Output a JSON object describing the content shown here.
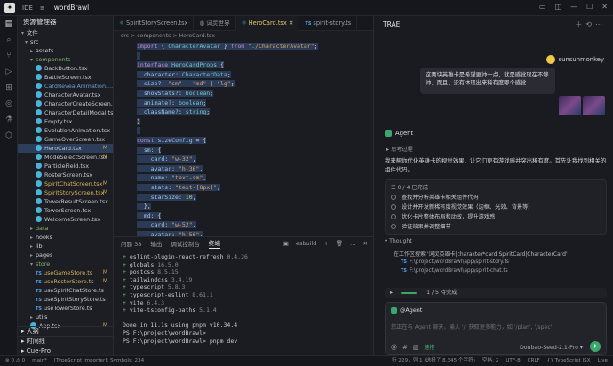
{
  "titlebar": {
    "ide_label": "IDE",
    "menu_label": "菜单",
    "project": "wordBrawl"
  },
  "explorer": {
    "title": "资源管理器",
    "root": "文件",
    "rows": [
      {
        "label": "src",
        "kind": "folder",
        "depth": 1,
        "open": true
      },
      {
        "label": "assets",
        "kind": "folder",
        "depth": 2,
        "open": false
      },
      {
        "label": "components",
        "kind": "folder",
        "depth": 2,
        "open": true,
        "state": "green"
      },
      {
        "label": "BackButton.tsx",
        "kind": "react",
        "depth": 3
      },
      {
        "label": "BattleScreen.tsx",
        "kind": "react",
        "depth": 3
      },
      {
        "label": "CardRevealAnimation....",
        "kind": "react",
        "depth": 3,
        "state": "del"
      },
      {
        "label": "CharacterAvatar.tsx",
        "kind": "react",
        "depth": 3
      },
      {
        "label": "CharacterCreateScreen.tsx",
        "kind": "react",
        "depth": 3
      },
      {
        "label": "CharacterDetailModal.tsx",
        "kind": "react",
        "depth": 3
      },
      {
        "label": "Empty.tsx",
        "kind": "react",
        "depth": 3
      },
      {
        "label": "EvolutionAnimation.tsx",
        "kind": "react",
        "depth": 3
      },
      {
        "label": "GameOverScreen.tsx",
        "kind": "react",
        "depth": 3
      },
      {
        "label": "HeroCard.tsx",
        "kind": "react",
        "depth": 3,
        "state": "sel",
        "badge": "M"
      },
      {
        "label": "ModeSelectScreen.tsx",
        "kind": "react",
        "depth": 3,
        "badge": "M"
      },
      {
        "label": "ParticleField.tsx",
        "kind": "react",
        "depth": 3
      },
      {
        "label": "RosterScreen.tsx",
        "kind": "react",
        "depth": 3
      },
      {
        "label": "SpiritChatScreen.tsx",
        "kind": "react",
        "depth": 3,
        "state": "mod",
        "badge": "M"
      },
      {
        "label": "SpiritStoryScreen.tsx",
        "kind": "react",
        "depth": 3,
        "state": "mod",
        "badge": "M"
      },
      {
        "label": "TowerResultScreen.tsx",
        "kind": "react",
        "depth": 3
      },
      {
        "label": "TowerScreen.tsx",
        "kind": "react",
        "depth": 3
      },
      {
        "label": "WelcomeScreen.tsx",
        "kind": "react",
        "depth": 3
      },
      {
        "label": "data",
        "kind": "folder",
        "depth": 2,
        "open": false,
        "state": "green"
      },
      {
        "label": "hooks",
        "kind": "folder",
        "depth": 2,
        "open": false
      },
      {
        "label": "lib",
        "kind": "folder",
        "depth": 2,
        "open": false
      },
      {
        "label": "pages",
        "kind": "folder",
        "depth": 2,
        "open": false
      },
      {
        "label": "store",
        "kind": "folder",
        "depth": 2,
        "open": true,
        "state": "green"
      },
      {
        "label": "useGameStore.ts",
        "kind": "ts",
        "depth": 3,
        "state": "mod",
        "badge": "M"
      },
      {
        "label": "useRosterStore.ts",
        "kind": "ts",
        "depth": 3,
        "state": "mod",
        "badge": "M"
      },
      {
        "label": "useSpiritChatStore.ts",
        "kind": "ts",
        "depth": 3
      },
      {
        "label": "useSpiritStoryStore.ts",
        "kind": "ts",
        "depth": 3
      },
      {
        "label": "useTowerStore.ts",
        "kind": "ts",
        "depth": 3
      },
      {
        "label": "utils",
        "kind": "folder",
        "depth": 2,
        "open": false
      },
      {
        "label": "App.tsx",
        "kind": "react",
        "depth": 2,
        "badge": "M"
      }
    ],
    "sections": [
      "大纲",
      "时间线",
      "Cue-Pro"
    ]
  },
  "editor": {
    "tabs": [
      {
        "label": "SpiritStoryScreen.tsx",
        "kind": "react",
        "active": false
      },
      {
        "label": "词灵世界",
        "kind": "web",
        "active": false
      },
      {
        "label": "HeroCard.tsx",
        "kind": "react",
        "active": true
      },
      {
        "label": "spirit-story.ts",
        "kind": "ts",
        "active": false
      }
    ],
    "breadcrumb": "src > components > HeroCard.tsx",
    "lines": [
      {
        "n": "",
        "html": "<span class=\"kw\">import</span> <span class=\"pl\">{ </span><span class=\"ty\">CharacterAvatar</span><span class=\"pl\"> } </span><span class=\"kw\">from</span> <span class=\"st\">\"./CharacterAvatar\"</span><span class=\"pl\">;</span>"
      },
      {
        "n": "",
        "html": ""
      },
      {
        "n": "",
        "html": "<span class=\"kw\">interface</span> <span class=\"ty\">HeroCardProps</span> <span class=\"pl\">{</span>"
      },
      {
        "n": "",
        "html": "  <span class=\"pr\">character</span><span class=\"pl\">: </span><span class=\"ty\">CharacterData</span><span class=\"pl\">;</span>"
      },
      {
        "n": "",
        "html": "  <span class=\"pr\">size?</span><span class=\"pl\">: </span><span class=\"st\">\"sm\"</span><span class=\"pl\"> | </span><span class=\"st\">\"md\"</span><span class=\"pl\"> | </span><span class=\"st\">\"lg\"</span><span class=\"pl\">;</span>"
      },
      {
        "n": "",
        "html": "  <span class=\"pr\">showStats?</span><span class=\"pl\">: </span><span class=\"ty\">boolean</span><span class=\"pl\">;</span>"
      },
      {
        "n": "",
        "html": "  <span class=\"pr\">animate?</span><span class=\"pl\">: </span><span class=\"ty\">boolean</span><span class=\"pl\">;</span>"
      },
      {
        "n": "",
        "html": "  <span class=\"pr\">className?</span><span class=\"pl\">: </span><span class=\"ty\">string</span><span class=\"pl\">;</span>"
      },
      {
        "n": "",
        "html": "<span class=\"pl\">}</span>"
      },
      {
        "n": "",
        "html": ""
      },
      {
        "n": "",
        "html": "<span class=\"kw\">const</span> <span class=\"pr\">sizeConfig</span><span class=\"pl\"> = {</span>"
      },
      {
        "n": "",
        "html": "  <span class=\"pr\">sm</span><span class=\"pl\">: {</span>"
      },
      {
        "n": "",
        "html": "    <span class=\"pr\">card</span><span class=\"pl\">: </span><span class=\"st\">\"w-32\"</span><span class=\"pl\">,</span>"
      },
      {
        "n": "",
        "html": "    <span class=\"pr\">avatar</span><span class=\"pl\">: </span><span class=\"st\">\"h-36\"</span><span class=\"pl\">,</span>"
      },
      {
        "n": "",
        "html": "    <span class=\"pr\">name</span><span class=\"pl\">: </span><span class=\"st\">\"text-sm\"</span><span class=\"pl\">,</span>"
      },
      {
        "n": "",
        "html": "    <span class=\"pr\">stats</span><span class=\"pl\">: </span><span class=\"st\">\"text-[8px]\"</span><span class=\"pl\">,</span>"
      },
      {
        "n": "",
        "html": "    <span class=\"pr\">starSize</span><span class=\"pl\">: </span><span class=\"nm\">10</span><span class=\"pl\">,</span>"
      },
      {
        "n": "",
        "html": "  <span class=\"pl\">},</span>"
      },
      {
        "n": "",
        "html": "  <span class=\"pr\">md</span><span class=\"pl\">: {</span>"
      },
      {
        "n": "",
        "html": "    <span class=\"pr\">card</span><span class=\"pl\">: </span><span class=\"st\">\"w-52\"</span><span class=\"pl\">,</span>"
      },
      {
        "n": "",
        "html": "    <span class=\"pr\">avatar</span><span class=\"pl\">: </span><span class=\"st\">\"h-56\"</span><span class=\"pl\">,</span>"
      },
      {
        "n": "",
        "html": "    <span class=\"pr\">name</span><span class=\"pl\">: </span><span class=\"st\">\"text-lg\"</span><span class=\"pl\">,</span>"
      }
    ]
  },
  "terminal": {
    "tabs": [
      {
        "label": "问题",
        "count": "38"
      },
      {
        "label": "输出"
      },
      {
        "label": "调试控制台"
      },
      {
        "label": "终端",
        "active": true
      }
    ],
    "session": "esbuild",
    "lines": [
      {
        "plus": "+",
        "pkg": "eslint-plugin-react-refresh",
        "ver": "0.4.26"
      },
      {
        "plus": "+",
        "pkg": "globals",
        "ver": "16.5.0"
      },
      {
        "plus": "+",
        "pkg": "postcss",
        "ver": "8.5.15"
      },
      {
        "plus": "+",
        "pkg": "tailwindcss",
        "ver": "3.4.19"
      },
      {
        "plus": "+",
        "pkg": "typescript",
        "ver": "5.8.3"
      },
      {
        "plus": "+",
        "pkg": "typescript-eslint",
        "ver": "8.61.1"
      },
      {
        "plus": "+",
        "pkg": "vite",
        "ver": "6.4.3"
      },
      {
        "plus": "+",
        "pkg": "vite-tsconfig-paths",
        "ver": "5.1.4"
      }
    ],
    "done": "Done in 11.1s using pnpm v10.34.4",
    "prompt1": "PS F:\\project\\wordBrawl>",
    "prompt2": "PS F:\\project\\wordBrawl> pnpm dev"
  },
  "chat": {
    "title": "TRAE",
    "user_name": "sunsunmonkey",
    "user_message": "这两块英雄卡是希望更帅一点，就是感觉现在不够帅，而且，没有体现出来稀有度哪个感觉",
    "agent_label": "Agent",
    "think_label": "思考过程",
    "agent_text": "我来帮你优化英雄卡的视觉效果，让它们更有游戏感并突出稀有度。首先让我找到相关的组件代码。",
    "todo_head": "0 / 4 已完成",
    "todos": [
      "查找并分析英雄卡相关组件代码",
      "设计并开发新稀有度视觉效果（边框、光效、背景等）",
      "优化卡片整体布局和动效，提升游戏感",
      "验证效果并调整细节"
    ],
    "thought_label": "Thought",
    "step_text": "在工作区搜索 '词灵英雄卡|character*card|SpiritCard|CharacterCard'",
    "files": [
      "F:\\project\\wordBrawl\\app\\spirit-story.ts",
      "F:\\project\\wordBrawl\\app\\spirit-chat.ts"
    ],
    "progress": "1 / 5 待完成",
    "mention": "@Agent",
    "placeholder": "您正在与 Agent 聊天，输入 '/' 获取更多能力，如 '/plan', '/spec'",
    "tools_label": "速搭",
    "model": "Doubao-Seed-2.1-Pro"
  },
  "statusbar": {
    "left": [
      "⊗ 0 ⚠ 0",
      "main*",
      "[TypeScript Importer]: Symbols: 234"
    ],
    "right": [
      "行 229，列 1 (选择了 8,345 个字符)",
      "空格: 2",
      "UTF-8",
      "CRLF",
      "{} TypeScript JSX",
      "Live"
    ]
  }
}
